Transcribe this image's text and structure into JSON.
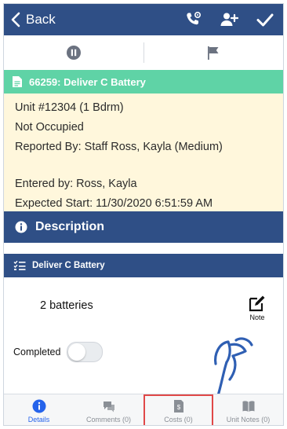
{
  "nav": {
    "back_label": "Back",
    "icons": [
      "phone-settings-icon",
      "add-user-icon",
      "checkmark-icon"
    ]
  },
  "toolbar": {
    "icons": [
      "pause-icon",
      "flag-icon"
    ]
  },
  "work_order": {
    "banner": "66259: Deliver C Battery",
    "lines": [
      "Unit #12304 (1 Bdrm)",
      "Not Occupied",
      "Reported By: Staff Ross, Kayla (Medium)",
      "Entered by: Ross, Kayla",
      "Expected Start: 11/30/2020 6:51:59 AM"
    ]
  },
  "description": {
    "header": "Description"
  },
  "task": {
    "title": "Deliver C Battery",
    "text": "2 batteries",
    "note_label": "Note",
    "completed_label": "Completed",
    "completed": false
  },
  "tabs": [
    {
      "label": "Details",
      "icon": "info-icon",
      "active": true
    },
    {
      "label": "Comments (0)",
      "icon": "comments-icon",
      "active": false
    },
    {
      "label": "Costs (0)",
      "icon": "costs-icon",
      "active": false,
      "highlighted": true
    },
    {
      "label": "Unit Notes (0)",
      "icon": "book-icon",
      "active": false
    }
  ],
  "colors": {
    "nav": "#2f4f86",
    "banner": "#5fd3a6",
    "info_bg": "#fff7dc",
    "active_tab": "#2563eb",
    "highlight": "#e04848",
    "annotation": "#2f5fb3"
  }
}
